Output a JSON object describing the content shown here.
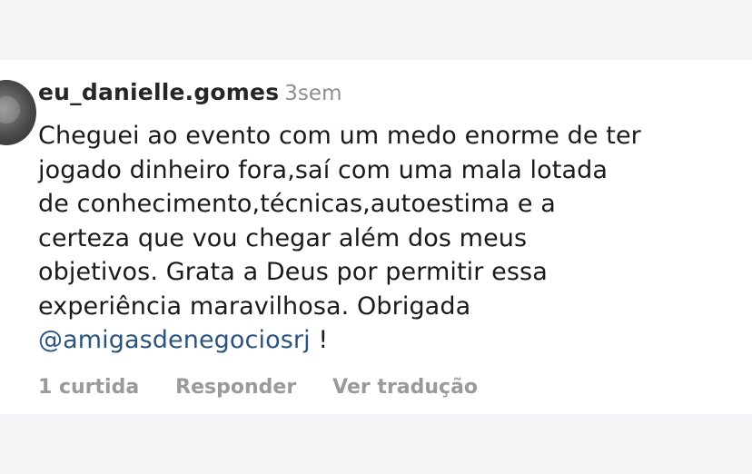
{
  "comment": {
    "username": "eu_danielle.gomes",
    "time_ago": "3sem",
    "text_lines": [
      "Cheguei ao evento com um medo enorme de ter",
      "jogado dinheiro fora,saí com uma mala lotada",
      "de conhecimento,técnicas,autoestima e a",
      "certeza que vou chegar além dos meus",
      "objetivos.  Grata a Deus por permitir essa",
      "experiência maravilhosa.  Obrigada"
    ],
    "mention": "@amigasdenegociosrj",
    "trailing": " !"
  },
  "actions": {
    "likes": "1 curtida",
    "reply": "Responder",
    "translate": "Ver tradução"
  },
  "colors": {
    "username": "#262626",
    "timestamp": "#8e8e8e",
    "mention": "#2b5480",
    "actions": "#9a9a9a",
    "background": "#ffffff"
  }
}
